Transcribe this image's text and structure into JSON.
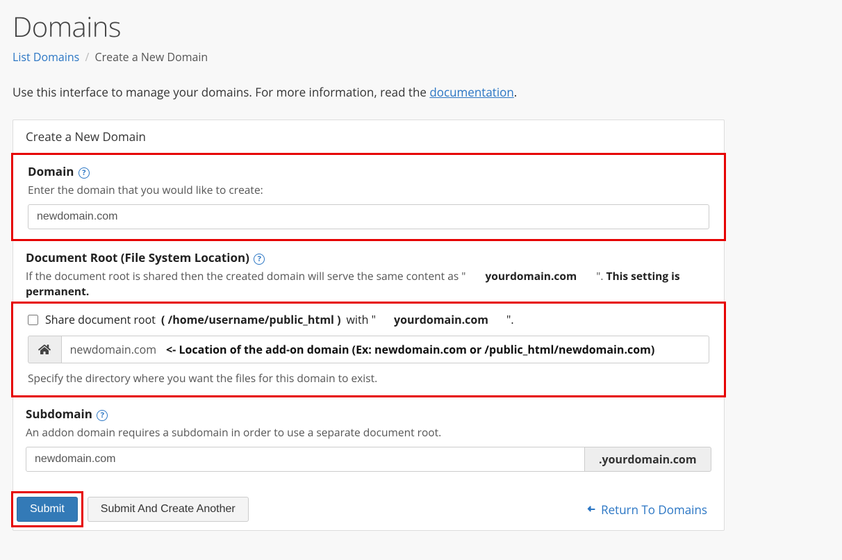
{
  "header": {
    "title": "Domains",
    "breadcrumb_link": "List Domains",
    "breadcrumb_current": "Create a New Domain"
  },
  "intro": {
    "text_before": "Use this interface to manage your domains. For more information, read the ",
    "doc_link": "documentation",
    "text_after": "."
  },
  "panel": {
    "title": "Create a New Domain"
  },
  "domain": {
    "label": "Domain",
    "help": "Enter the domain that you would like to create:",
    "value": "newdomain.com"
  },
  "docroot": {
    "label": "Document Root (File System Location)",
    "help_before": "If the document root is shared then the created domain will serve the same content as \"",
    "shared_domain": "yourdomain.com",
    "help_after_quote": "\". ",
    "permanent": "This setting is permanent.",
    "share_label_1": "Share document root",
    "share_path": "( /home/username/public_html )",
    "share_label_2": "with \"",
    "share_domain": "yourdomain.com",
    "share_label_3": "\".",
    "location_value": "newdomain.com",
    "location_hint": "<- Location of the add-on domain (Ex: newdomain.com or /public_html/newdomain.com)",
    "specify": "Specify the directory where you want the files for this domain to exist."
  },
  "subdomain": {
    "label": "Subdomain",
    "help": "An addon domain requires a subdomain in order to use a separate document root.",
    "value": "newdomain.com",
    "suffix": ".yourdomain.com"
  },
  "buttons": {
    "submit": "Submit",
    "submit_another": "Submit And Create Another",
    "return": "Return To Domains"
  }
}
